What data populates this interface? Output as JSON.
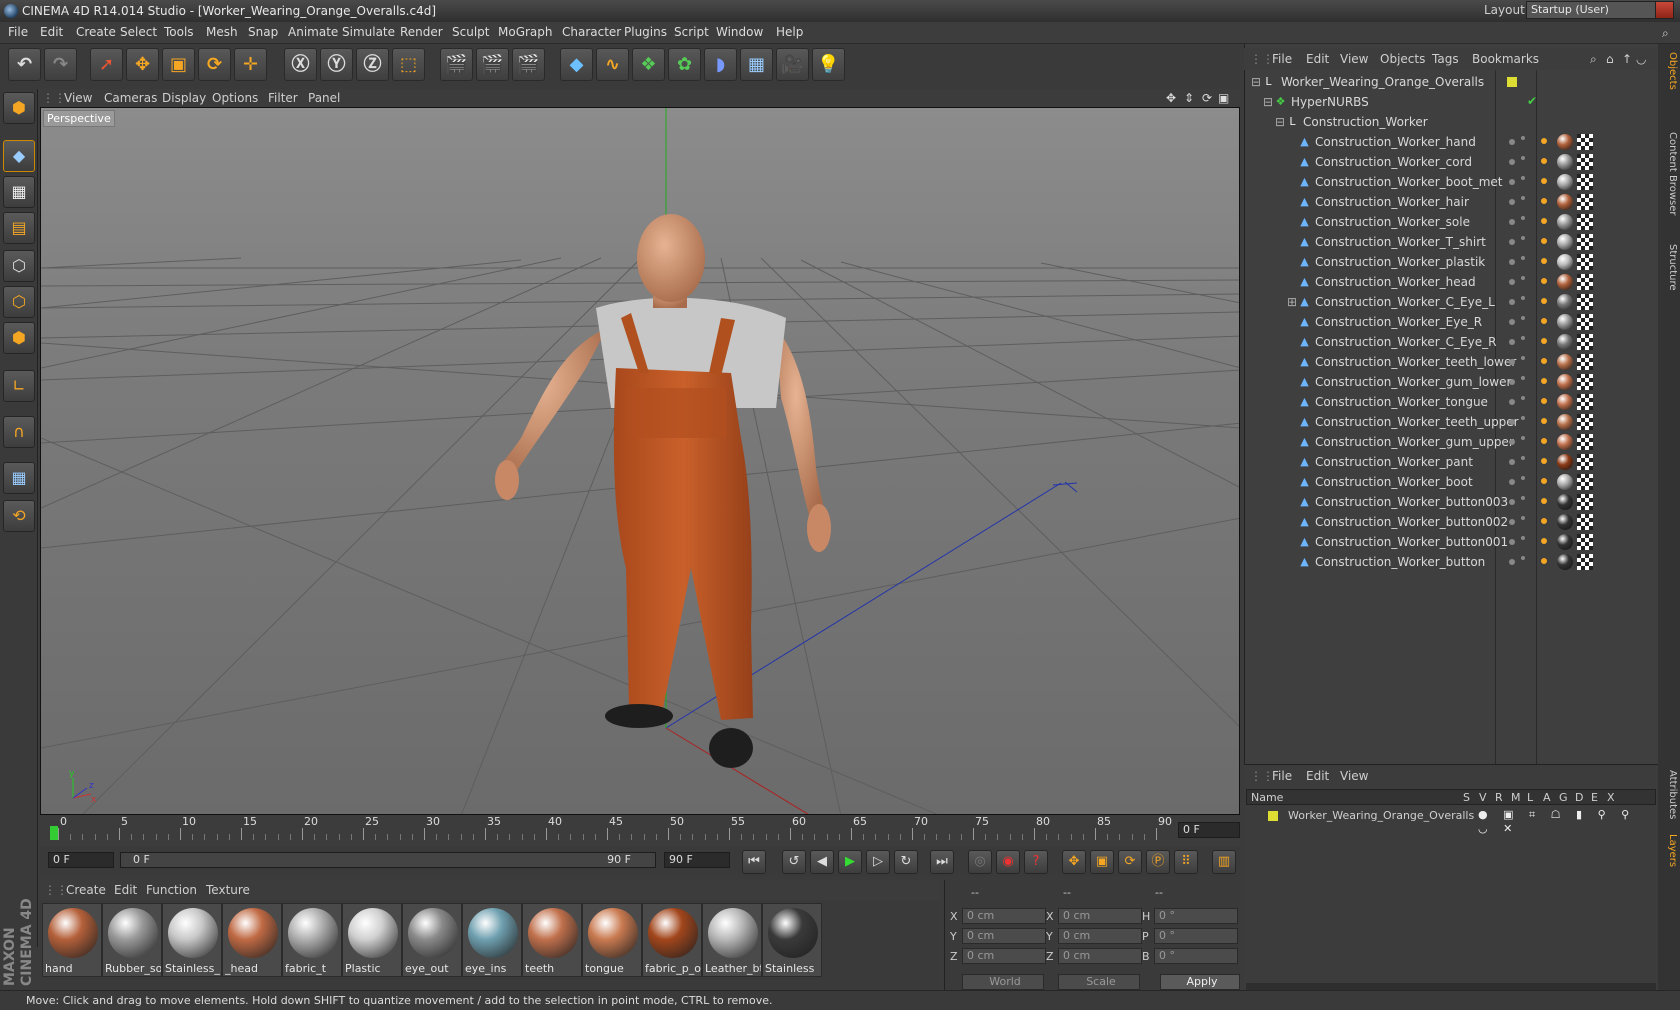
{
  "window": {
    "title": "CINEMA 4D R14.014 Studio - [Worker_Wearing_Orange_Overalls.c4d]"
  },
  "menubar": {
    "items": [
      "File",
      "Edit",
      "Create",
      "Select",
      "Tools",
      "Mesh",
      "Snap",
      "Animate",
      "Simulate",
      "Render",
      "Sculpt",
      "MoGraph",
      "Character",
      "Plugins",
      "Script",
      "Window",
      "Help"
    ],
    "layout_label": "Layout:",
    "layout_value": "Startup (User)"
  },
  "viewport": {
    "menu": [
      "View",
      "Cameras",
      "Display",
      "Options",
      "Filter",
      "Panel"
    ],
    "label": "Perspective"
  },
  "timeline": {
    "ticks": [
      "0",
      "5",
      "10",
      "15",
      "20",
      "25",
      "30",
      "35",
      "40",
      "45",
      "50",
      "55",
      "60",
      "65",
      "70",
      "75",
      "80",
      "85",
      "90"
    ],
    "current_frame": "0 F",
    "start_field": "0 F",
    "range_start": "0 F",
    "range_end": "90 F",
    "end_field": "90 F"
  },
  "material_manager": {
    "menu": [
      "Create",
      "Edit",
      "Function",
      "Texture"
    ],
    "materials": [
      {
        "name": "hand",
        "color": "#b4603a"
      },
      {
        "name": "Rubber_so",
        "color": "#9a9a9a"
      },
      {
        "name": "Stainless_",
        "color": "#c8c8c8"
      },
      {
        "name": "_head",
        "color": "#c06a44"
      },
      {
        "name": "fabric_t",
        "color": "#b0b0b0"
      },
      {
        "name": "Plastic",
        "color": "#d0d0d0"
      },
      {
        "name": "eye_out",
        "color": "#8a8a8a"
      },
      {
        "name": "eye_ins",
        "color": "#6fa0b0"
      },
      {
        "name": "teeth",
        "color": "#c0704c"
      },
      {
        "name": "tongue",
        "color": "#c97a50"
      },
      {
        "name": "fabric_p_o",
        "color": "#a2461c"
      },
      {
        "name": "Leather_bt",
        "color": "#b8b8b8"
      },
      {
        "name": "Stainless",
        "color": "#3a3a3a"
      }
    ]
  },
  "coordinates": {
    "headers": [
      "--",
      "--",
      "--"
    ],
    "rows": [
      {
        "a": "X",
        "av": "0 cm",
        "b": "X",
        "bv": "0 cm",
        "c": "H",
        "cv": "0 °"
      },
      {
        "a": "Y",
        "av": "0 cm",
        "b": "Y",
        "bv": "0 cm",
        "c": "P",
        "cv": "0 °"
      },
      {
        "a": "Z",
        "av": "0 cm",
        "b": "Z",
        "bv": "0 cm",
        "c": "B",
        "cv": "0 °"
      }
    ],
    "mode1": "World",
    "mode2": "Scale",
    "apply": "Apply"
  },
  "object_manager": {
    "menu": [
      "File",
      "Edit",
      "View",
      "Objects",
      "Tags",
      "Bookmarks"
    ],
    "root": "Worker_Wearing_Orange_Overalls",
    "nurbs": "HyperNURBS",
    "group": "Construction_Worker",
    "objects": [
      {
        "name": "Construction_Worker_hand",
        "tag": "#b0603a"
      },
      {
        "name": "Construction_Worker_cord",
        "tag": "#999999"
      },
      {
        "name": "Construction_Worker_boot_met",
        "tag": "#aaaaaa"
      },
      {
        "name": "Construction_Worker_hair",
        "tag": "#b0603a"
      },
      {
        "name": "Construction_Worker_sole",
        "tag": "#999999"
      },
      {
        "name": "Construction_Worker_T_shirt",
        "tag": "#aaaaaa"
      },
      {
        "name": "Construction_Worker_plastik",
        "tag": "#bbbbbb"
      },
      {
        "name": "Construction_Worker_head",
        "tag": "#b0603a"
      },
      {
        "name": "Construction_Worker_C_Eye_L",
        "tag": "#777777"
      },
      {
        "name": "Construction_Worker_Eye_R",
        "tag": "#999999"
      },
      {
        "name": "Construction_Worker_C_Eye_R",
        "tag": "#777777"
      },
      {
        "name": "Construction_Worker_teeth_lower",
        "tag": "#b8704a"
      },
      {
        "name": "Construction_Worker_gum_lower",
        "tag": "#c0704c"
      },
      {
        "name": "Construction_Worker_tongue",
        "tag": "#c0704c"
      },
      {
        "name": "Construction_Worker_teeth_upper",
        "tag": "#b8704a"
      },
      {
        "name": "Construction_Worker_gum_upper",
        "tag": "#c0704c"
      },
      {
        "name": "Construction_Worker_pant",
        "tag": "#8c3a16"
      },
      {
        "name": "Construction_Worker_boot",
        "tag": "#aaaaaa"
      },
      {
        "name": "Construction_Worker_button003",
        "tag": "#333333"
      },
      {
        "name": "Construction_Worker_button002",
        "tag": "#333333"
      },
      {
        "name": "Construction_Worker_button001",
        "tag": "#333333"
      },
      {
        "name": "Construction_Worker_button",
        "tag": "#333333"
      }
    ]
  },
  "layer_manager": {
    "menu": [
      "File",
      "Edit",
      "View"
    ],
    "name_header": "Name",
    "columns": [
      "S",
      "V",
      "R",
      "M",
      "L",
      "A",
      "G",
      "D",
      "E",
      "X"
    ],
    "layer": "Worker_Wearing_Orange_Overalls"
  },
  "side_tabs": [
    "Objects",
    "Content Browser",
    "Structure",
    "Attributes",
    "Layers"
  ],
  "status": "Move: Click and drag to move elements. Hold down SHIFT to quantize movement / add to the selection in point mode, CTRL to remove.",
  "brand": "MAXON CINEMA 4D"
}
